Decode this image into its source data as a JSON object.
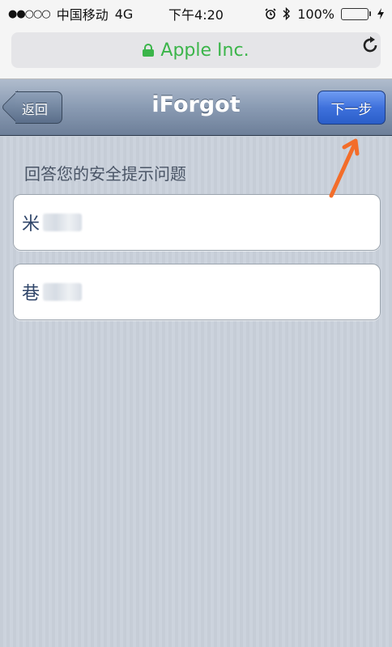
{
  "status_bar": {
    "signal": "●●○○○",
    "carrier": "中国移动",
    "network": "4G",
    "time": "下午4:20",
    "battery": "100%",
    "battery_level": 1.0
  },
  "browser": {
    "url_label": "Apple Inc.",
    "lock_icon": "lock-icon",
    "reload_icon": "reload-icon",
    "secure_color": "#3bb54a"
  },
  "navbar": {
    "title": "iForgot",
    "back_label": "返回",
    "next_label": "下一步"
  },
  "content": {
    "prompt": "回答您的安全提示问题",
    "answers": [
      {
        "visible_char": "米"
      },
      {
        "visible_char": "巷"
      }
    ]
  },
  "colors": {
    "accent_blue": "#3f71dc",
    "annotation_orange": "#f36d2a"
  }
}
